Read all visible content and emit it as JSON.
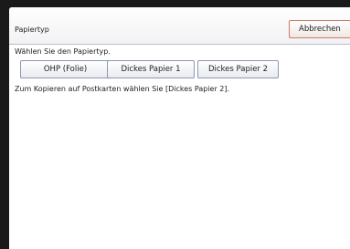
{
  "header": {
    "title": "Papiertyp",
    "cancel_label": "Abbrechen"
  },
  "main": {
    "instruction": "Wählen Sie den Papiertyp.",
    "paper_types": [
      {
        "label": "OHP (Folie)"
      },
      {
        "label": "Dickes Papier 1"
      },
      {
        "label": "Dickes Papier 2"
      }
    ],
    "note": "Zum Kopieren auf Postkarten wählen Sie [Dickes Papier 2]."
  },
  "colors": {
    "cancel_border": "#c67b6a",
    "button_border": "#8e97b2",
    "frame": "#1a1a1a"
  }
}
